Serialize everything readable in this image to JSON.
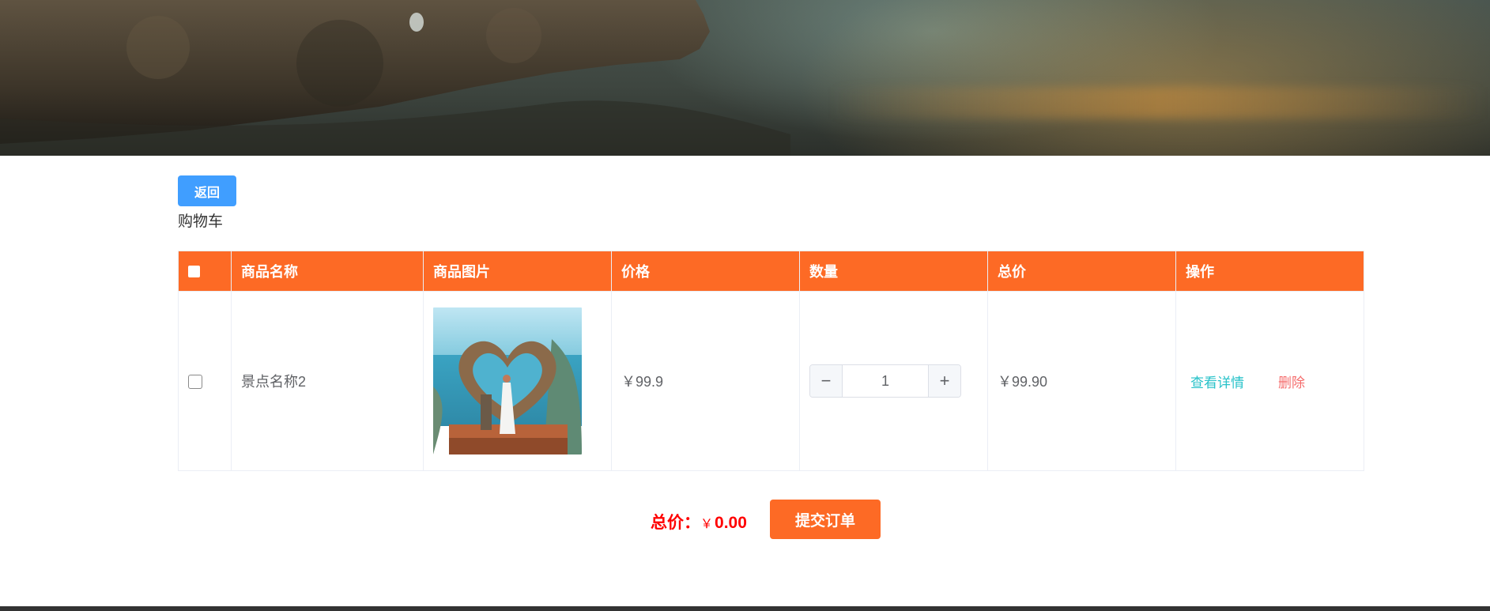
{
  "hero": {
    "icon": "landscape-banner-image"
  },
  "back_label": "返回",
  "page_title": "购物车",
  "table": {
    "headers": [
      "商品名称",
      "商品图片",
      "价格",
      "数量",
      "总价",
      "操作"
    ],
    "rows": [
      {
        "name": "景点名称2",
        "image_icon": "heart-swing-photo",
        "price": "￥99.9",
        "quantity": "1",
        "total": "￥99.90",
        "detail_label": "查看详情",
        "delete_label": "删除"
      }
    ]
  },
  "summary": {
    "total_label": "总价：",
    "currency": "￥",
    "total_value": "0.00",
    "submit_label": "提交订单"
  },
  "colors": {
    "accent": "#fd6a25",
    "primary_button": "#409eff",
    "total_text": "#ff0000",
    "detail_link": "#27c2c9",
    "delete_link": "#f56c6c"
  }
}
